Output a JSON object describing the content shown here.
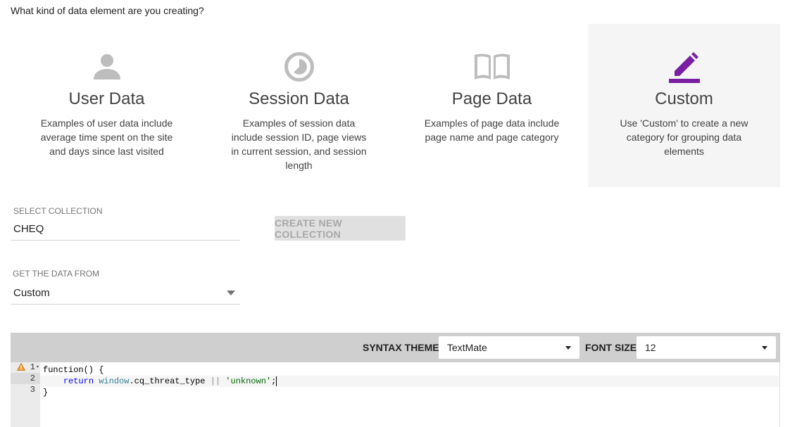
{
  "question": "What kind of data element are you creating?",
  "cards": [
    {
      "icon": "person-icon",
      "title": "User Data",
      "description": "Examples of user data include average time spent on the site and days since last visited"
    },
    {
      "icon": "timer-icon",
      "title": "Session Data",
      "description": "Examples of session data include session ID, page views in current session, and session length"
    },
    {
      "icon": "book-icon",
      "title": "Page Data",
      "description": "Examples of page data include page name and page category"
    },
    {
      "icon": "edit-icon",
      "title": "Custom",
      "description": "Use 'Custom' to create a new category for grouping data elements",
      "selected": true
    }
  ],
  "collection": {
    "label": "SELECT COLLECTION",
    "value": "CHEQ",
    "create_button": "CREATE NEW COLLECTION"
  },
  "source": {
    "label": "GET THE DATA FROM",
    "value": "Custom"
  },
  "editor": {
    "syntax_theme_label": "SYNTAX THEME",
    "syntax_theme_value": "TextMate",
    "font_size_label": "FONT SIZE",
    "font_size_value": "12",
    "line_numbers": [
      "1",
      "2",
      "3"
    ],
    "code": {
      "line1": "function() {",
      "line2_keyword": "return",
      "line2_var": "window",
      "line2_prop": ".cq_threat_type",
      "line2_op": "||",
      "line2_str": "'unknown'",
      "line2_end": ";",
      "line3": "}"
    }
  },
  "colors": {
    "accent": "#7b1fa2",
    "icon_grey": "#bdbdbd"
  }
}
